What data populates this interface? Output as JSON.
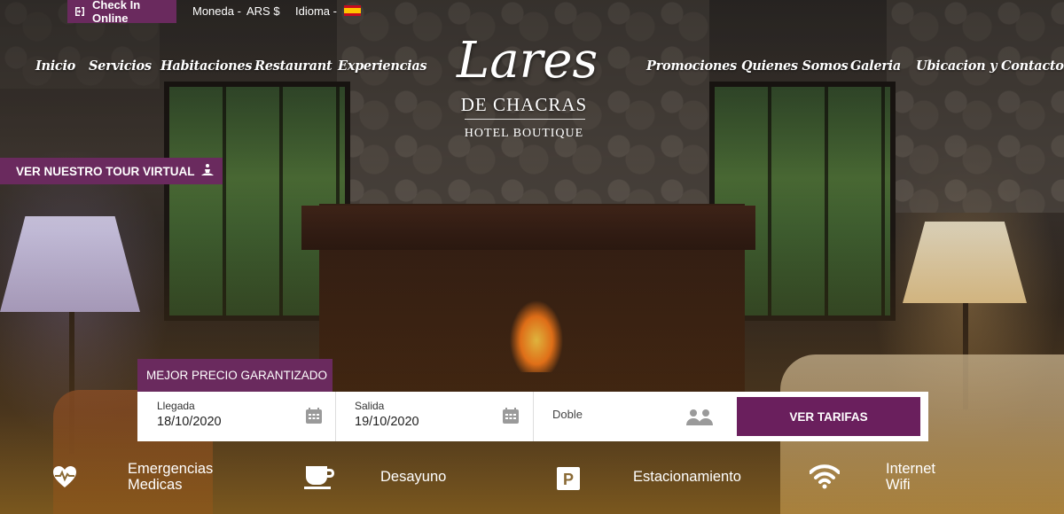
{
  "topbar": {
    "checkin_label": "Check In Online",
    "moneda_label": "Moneda -",
    "moneda_value": "ARS $",
    "idioma_label": "Idioma -"
  },
  "nav": {
    "left": [
      "Inicio",
      "Servicios",
      "Habitaciones",
      "Restaurant",
      "Experiencias"
    ],
    "right": [
      "Promociones",
      "Quienes Somos",
      "Galeria",
      "Ubicacion y Contacto"
    ]
  },
  "logo": {
    "main": "Lares",
    "sub": "DE CHACRAS",
    "tag": "HOTEL BOUTIQUE"
  },
  "tour": {
    "label": "VER NUESTRO TOUR VIRTUAL"
  },
  "booking": {
    "badge": "MEJOR PRECIO GARANTIZADO",
    "llegada_label": "Llegada",
    "llegada_value": "18/10/2020",
    "salida_label": "Salida",
    "salida_value": "19/10/2020",
    "room_value": "Doble",
    "button_label": "VER TARIFAS"
  },
  "amenities": [
    {
      "icon": "heart-pulse-icon",
      "line1": "Emergencias",
      "line2": "Medicas"
    },
    {
      "icon": "coffee-cup-icon",
      "line1": "Desayuno",
      "line2": ""
    },
    {
      "icon": "parking-icon",
      "line1": "Estacionamiento",
      "line2": ""
    },
    {
      "icon": "wifi-icon",
      "line1": "Internet",
      "line2": "Wifi"
    }
  ],
  "colors": {
    "brand_purple": "#6a2a5e",
    "button_purple": "#6a1f5d"
  }
}
